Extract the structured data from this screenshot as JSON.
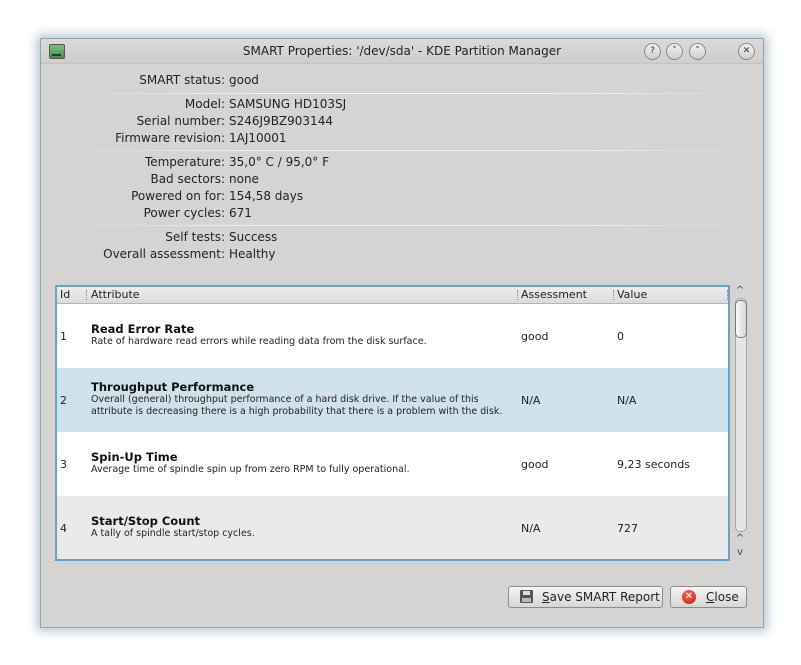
{
  "window": {
    "title": "SMART Properties: '/dev/sda' - KDE Partition Manager",
    "controls": {
      "help": "?",
      "minimize": "˅",
      "maximize": "˄",
      "close": "✕"
    }
  },
  "properties": [
    {
      "label": "SMART status:",
      "value": "good"
    },
    {
      "label": "Model:",
      "value": "SAMSUNG HD103SJ"
    },
    {
      "label": "Serial number:",
      "value": "S246J9BZ903144"
    },
    {
      "label": "Firmware revision:",
      "value": "1AJ10001"
    },
    {
      "label": "Temperature:",
      "value": "35,0° C / 95,0° F"
    },
    {
      "label": "Bad sectors:",
      "value": "none"
    },
    {
      "label": "Powered on for:",
      "value": "154,58 days"
    },
    {
      "label": "Power cycles:",
      "value": "671"
    },
    {
      "label": "Self tests:",
      "value": "Success"
    },
    {
      "label": "Overall assessment:",
      "value": "Healthy"
    }
  ],
  "table": {
    "headers": [
      "Id",
      "Attribute",
      "Assessment",
      "Value"
    ],
    "rows": [
      {
        "id": "1",
        "title": "Read Error Rate",
        "desc": "Rate of hardware read errors while reading data from the disk surface.",
        "desc2": "",
        "assessment": "good",
        "value": "0"
      },
      {
        "id": "2",
        "title": "Throughput Performance",
        "desc": "Overall (general) throughput performance of a hard disk drive. If the value of this",
        "desc2": "attribute is decreasing there is a high probability that there is a problem with the disk.",
        "assessment": "N/A",
        "value": "N/A"
      },
      {
        "id": "3",
        "title": "Spin-Up Time",
        "desc": "Average time of spindle spin up from zero RPM to fully operational.",
        "desc2": "",
        "assessment": "good",
        "value": "9,23 seconds"
      },
      {
        "id": "4",
        "title": "Start/Stop Count",
        "desc": "A tally of spindle start/stop cycles.",
        "desc2": "",
        "assessment": "N/A",
        "value": "727"
      }
    ]
  },
  "buttons": {
    "save_mnemonic": "S",
    "save_rest": "ave SMART Report",
    "close_mnemonic": "C",
    "close_rest": "lose"
  },
  "colors": {
    "selection": "#cfe1eb",
    "alt_row": "#ebeae9",
    "focus_border": "#62a4d6"
  }
}
